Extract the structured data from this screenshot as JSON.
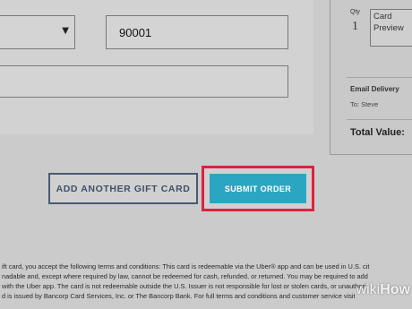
{
  "form": {
    "zip_value": "90001",
    "select_chevron": "chevron-down-icon"
  },
  "summary": {
    "qty_label": "Qty",
    "qty_value": "1",
    "card_preview_line1": "Card",
    "card_preview_line2": "Preview",
    "email_delivery_label": "Email Delivery",
    "to_line": "To: Steve",
    "total_label": "Total Value:"
  },
  "actions": {
    "add_gift_card_label": "ADD ANOTHER GIFT CARD",
    "submit_order_label": "SUBMIT ORDER"
  },
  "legal": {
    "line1": "ift card, you accept the following terms and conditions: This card is redeemable via the Uber® app and can be used in U.S. cit",
    "line2": "nadable and, except where required by law, cannot be redeemed for cash, refunded, or returned. You may be required to add",
    "line3": "with the Uber app. The card is not redeemable outside the U.S. Issuer is not responsible for lost or stolen cards, or unauthori",
    "line4": "d is issued by Bancorp Card Services, Inc. or The Bancorp Bank. For full terms and conditions and customer service visit"
  },
  "watermark": {
    "wiki": "wiki",
    "how": "How"
  }
}
